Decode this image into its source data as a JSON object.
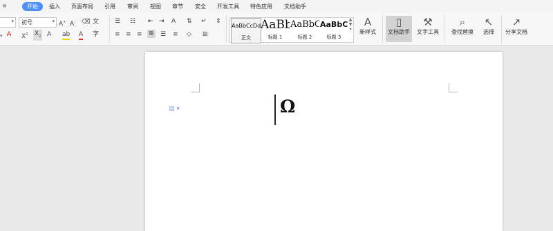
{
  "quick_access": "≌",
  "menu": {
    "tabs": [
      {
        "label": "开始",
        "active": true
      },
      {
        "label": "插入"
      },
      {
        "label": "页面布局"
      },
      {
        "label": "引用"
      },
      {
        "label": "审阅"
      },
      {
        "label": "视图"
      },
      {
        "label": "章节"
      },
      {
        "label": "安全"
      },
      {
        "label": "开发工具"
      },
      {
        "label": "特色应用"
      },
      {
        "label": "文档助手"
      }
    ]
  },
  "ribbon": {
    "font_size": "初号",
    "styles": [
      {
        "preview": "AaBbCcDd",
        "label": "正文"
      },
      {
        "preview": "AaBb",
        "label": "标题 1"
      },
      {
        "preview": "AaBbC",
        "label": "标题 2"
      },
      {
        "preview": "AaBbC",
        "label": "标题 3"
      }
    ],
    "new_style": "新样式",
    "doc_assistant": "文档助手",
    "text_tools": "文字工具",
    "find_replace": "查找替换",
    "select": "选择",
    "share_doc": "分享文档"
  },
  "document": {
    "content": "Ω"
  }
}
